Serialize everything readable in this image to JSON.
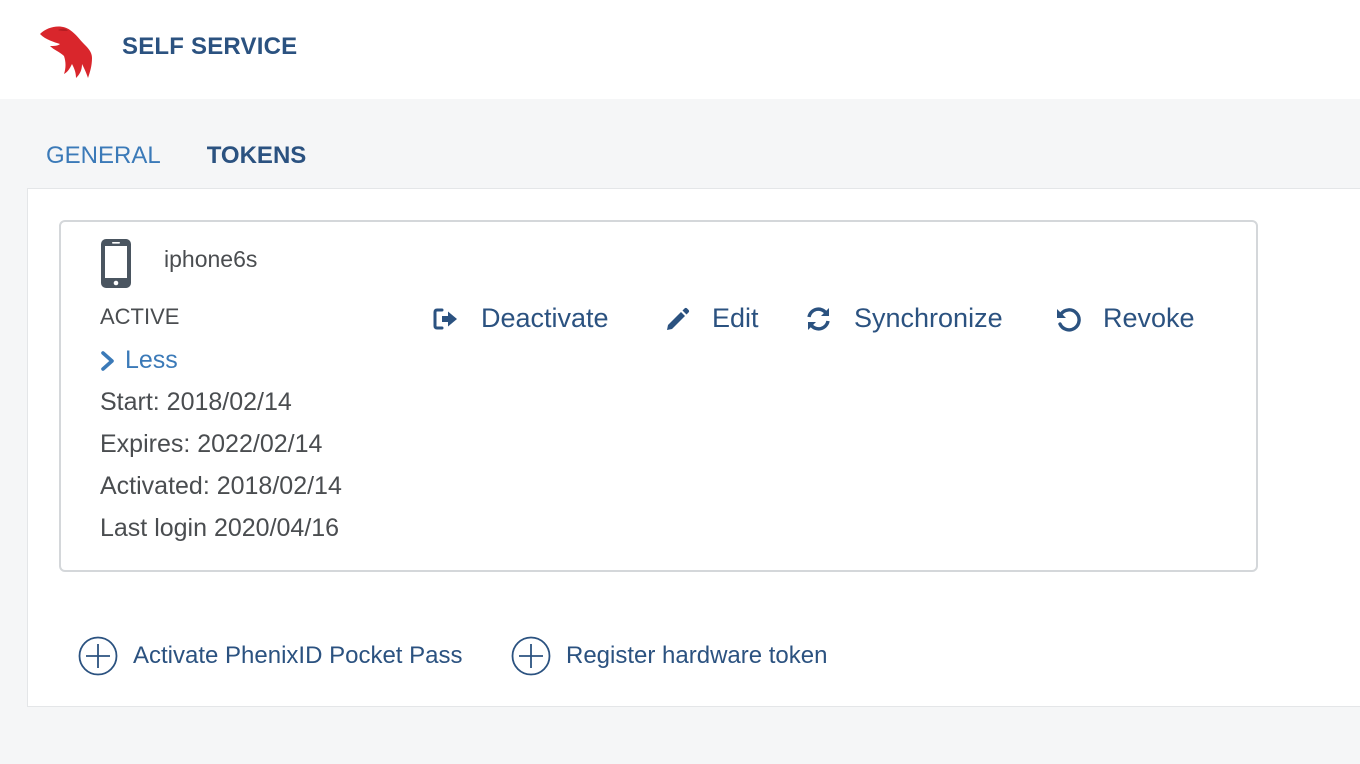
{
  "header": {
    "title": "SELF SERVICE",
    "logo_icon": "phenix-bird-logo",
    "logo_color": "#d9262c"
  },
  "tabs": [
    {
      "label": "GENERAL",
      "active": false
    },
    {
      "label": "TOKENS",
      "active": true
    }
  ],
  "token": {
    "icon": "mobile-phone-icon",
    "name": "iphone6s",
    "status": "ACTIVE",
    "toggle_label": "Less",
    "start": "Start: 2018/02/14",
    "expires": "Expires: 2022/02/14",
    "activated": "Activated: 2018/02/14",
    "last_login": "Last login 2020/04/16",
    "actions": {
      "deactivate": "Deactivate",
      "edit": "Edit",
      "synchronize": "Synchronize",
      "revoke": "Revoke"
    }
  },
  "add_links": {
    "pocket_pass": "Activate PhenixID Pocket Pass",
    "hardware_token": "Register hardware token"
  },
  "colors": {
    "primary": "#2b5280",
    "link": "#3b7ab8",
    "text": "#4a4d50",
    "border": "#d4d7da",
    "page_bg": "#f5f6f7"
  }
}
